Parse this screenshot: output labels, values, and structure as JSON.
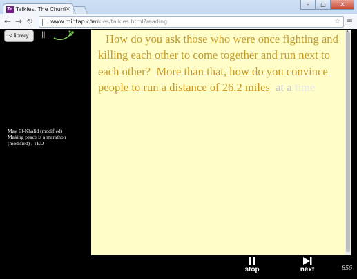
{
  "browser": {
    "tab_title": "Talkies. The Chunk Player",
    "favicon_text": "Ta",
    "url_domain": "www.mintap.com",
    "url_path": "/talkies/talkies.html?reading",
    "icons": [
      "back-arrow-icon",
      "forward-arrow-icon",
      "reload-icon",
      "star-icon",
      "menu-icon",
      "close-icon"
    ]
  },
  "app": {
    "library_label": "< library",
    "source": {
      "speaker": "May El-Khalid (modified)",
      "title": "Making peace is a marathon",
      "title_suffix": "(modified) / ",
      "link_label": "TED"
    },
    "reading": {
      "read_text_1": "How do you ask those who were once fighting  and killing each other  to come together and run next to each other?",
      "current_chunk": "More than that, how do you convince people to run a distance of 26.2 miles",
      "upcoming_chunk": "at a ",
      "upcoming_faint": "time"
    },
    "controls": {
      "stop_label": "stop",
      "next_label": "next"
    },
    "counter": "856",
    "colors": {
      "reader_bg": "#fffdc8",
      "text_color": "#c29b2a",
      "upcoming_color": "#c9c9c9"
    }
  }
}
